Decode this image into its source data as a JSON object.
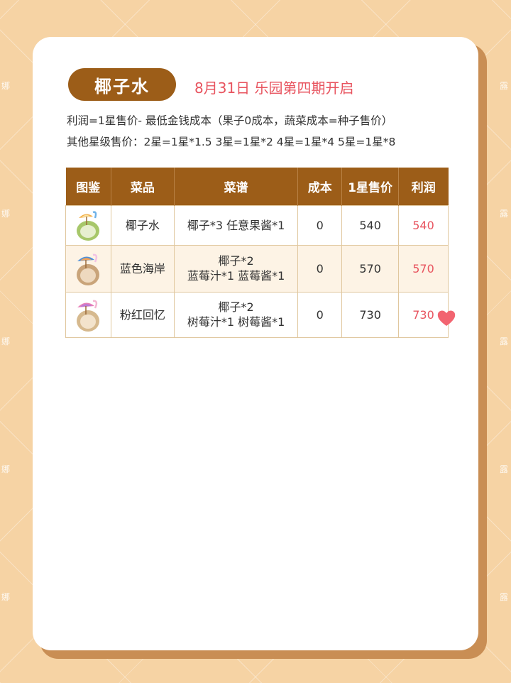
{
  "title": "椰子水",
  "headline": "8月31日 乐园第四期开启",
  "description": {
    "line1": "利润=1星售价- 最低金钱成本（果子0成本，蔬菜成本=种子售价）",
    "line2": "其他星级售价：2星=1星*1.5  3星=1星*2  4星=1星*4  5星=1星*8"
  },
  "table": {
    "headers": [
      "图鉴",
      "菜品",
      "菜谱",
      "成本",
      "1星售价",
      "利润"
    ],
    "rows": [
      {
        "dish": "椰子水",
        "recipe_line1": "椰子*3  任意果酱*1",
        "recipe_line2": "",
        "cost": "0",
        "price": "540",
        "profit": "540",
        "icon": "coconut-drink-white-umbrella-icon"
      },
      {
        "dish": "蓝色海岸",
        "recipe_line1": "椰子*2",
        "recipe_line2": "蓝莓汁*1 蓝莓酱*1",
        "cost": "0",
        "price": "570",
        "profit": "570",
        "icon": "coconut-drink-blue-umbrella-icon"
      },
      {
        "dish": "粉红回忆",
        "recipe_line1": "椰子*2",
        "recipe_line2": "树莓汁*1 树莓酱*1",
        "cost": "0",
        "price": "730",
        "profit": "730",
        "icon": "coconut-drink-pink-umbrella-icon"
      }
    ]
  },
  "watermark_chars": [
    "娜",
    "露"
  ],
  "colors": {
    "background": "#f6d3a4",
    "header_brown": "#9c5d18",
    "accent_red": "#e8545f",
    "row_alt": "#fdf3e5"
  }
}
